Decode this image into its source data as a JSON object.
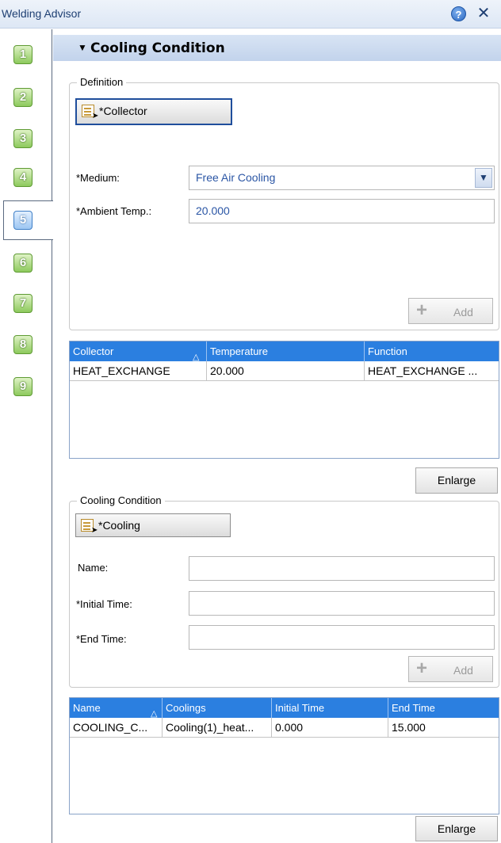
{
  "window": {
    "title": "Welding Advisor",
    "help_icon": "help-icon",
    "close_icon": "close-icon"
  },
  "steps": [
    "1",
    "2",
    "3",
    "4",
    "5",
    "6",
    "7",
    "8",
    "9"
  ],
  "active_step": "5",
  "section": {
    "title": "Cooling Condition"
  },
  "definition": {
    "legend": "Definition",
    "collector_button": "*Collector",
    "medium_label": "*Medium:",
    "medium_value": "Free Air Cooling",
    "ambient_label": "*Ambient Temp.:",
    "ambient_value": "20.000",
    "add_label": "Add"
  },
  "collector_table": {
    "columns": [
      "Collector",
      "Temperature",
      "Function"
    ],
    "rows": [
      [
        "HEAT_EXCHANGE",
        "20.000",
        "HEAT_EXCHANGE ..."
      ]
    ]
  },
  "enlarge_label": "Enlarge",
  "cooling_condition": {
    "legend": "Cooling Condition",
    "cooling_button": "*Cooling",
    "name_label": "Name:",
    "name_value": "",
    "initial_label": "*Initial Time:",
    "initial_value": "",
    "end_label": "*End Time:",
    "end_value": "",
    "add_label": "Add"
  },
  "cooling_table": {
    "columns": [
      "Name",
      "Coolings",
      "Initial Time",
      "End Time"
    ],
    "rows": [
      [
        "COOLING_C...",
        "Cooling(1)_heat...",
        "0.000",
        "15.000"
      ]
    ]
  },
  "colors": {
    "grid_header": "#2b7fe0",
    "step_green": "#8dc95d",
    "step_active": "#9cc6f2",
    "field_text": "#2b56a5"
  }
}
